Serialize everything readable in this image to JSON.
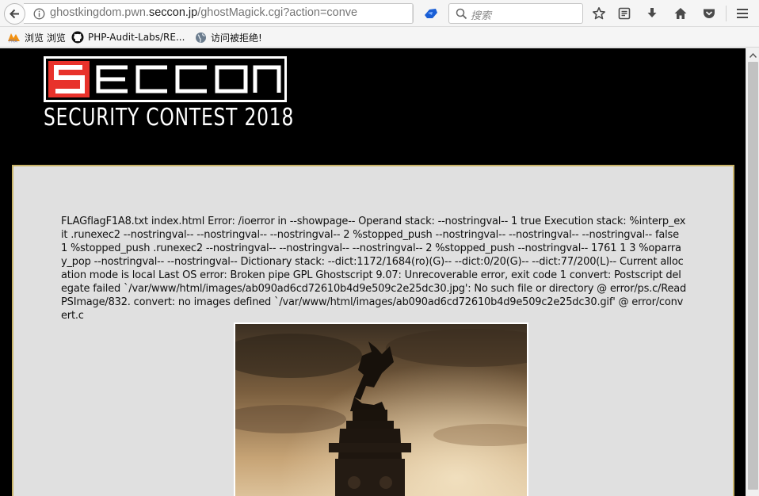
{
  "browser": {
    "url_prefix": "ghostkingdom.pwn.",
    "url_domain": "seccon.jp",
    "url_path": "/ghostMagick.cgi?action=conve",
    "search_placeholder": "搜索"
  },
  "bookmarks": [
    {
      "label": "浏览 浏览",
      "icon": "pma-icon"
    },
    {
      "label": "PHP-Audit-Labs/RE...",
      "icon": "github-icon"
    },
    {
      "label": "访问被拒绝!",
      "icon": "globe-icon"
    }
  ],
  "header": {
    "logo_text": "SECCON",
    "tagline": "SECURITY CONTEST 2018"
  },
  "output": {
    "text": "FLAGflagF1A8.txt index.html Error: /ioerror in --showpage-- Operand stack: --nostringval-- 1 true Execution stack: %interp_exit .runexec2 --nostringval-- --nostringval-- --nostringval-- 2 %stopped_push --nostringval-- --nostringval-- --nostringval-- false 1 %stopped_push .runexec2 --nostringval-- --nostringval-- --nostringval-- 2 %stopped_push --nostringval-- 1761 1 3 %oparray_pop --nostringval-- --nostringval-- Dictionary stack: --dict:1172/1684(ro)(G)-- --dict:0/20(G)-- --dict:77/200(L)-- Current allocation mode is local Last OS error: Broken pipe GPL Ghostscript 9.07: Unrecoverable error, exit code 1 convert: Postscript delegate failed `/var/www/html/images/ab090ad6cd72610b4d9e509c2e25dc30.jpg': No such file or directory @ error/ps.c/ReadPSImage/832. convert: no images defined `/var/www/html/images/ab090ad6cd72610b4d9e509c2e25dc30.gif' @ error/convert.c"
  },
  "colors": {
    "logo_red": "#e8322b",
    "panel_bg": "#e0e0e0",
    "panel_border": "#c9b46a"
  }
}
